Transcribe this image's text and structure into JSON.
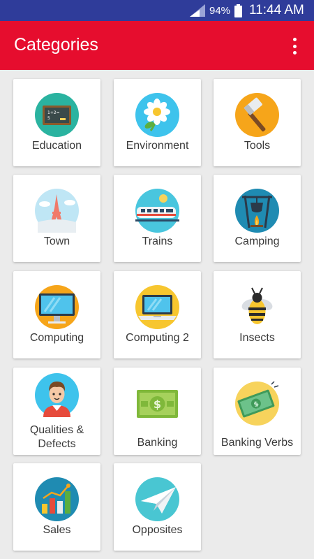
{
  "status_bar": {
    "battery": "94%",
    "time": "11:44 AM"
  },
  "app_bar": {
    "title": "Categories",
    "menu_icon": "more-vert-icon"
  },
  "colors": {
    "status": "#2f3c9a",
    "app_bar": "#e60d2e",
    "background": "#ebebeb"
  },
  "categories": [
    {
      "label": "Education",
      "icon": "chalkboard-icon"
    },
    {
      "label": "Environment",
      "icon": "flower-icon"
    },
    {
      "label": "Tools",
      "icon": "hammer-icon"
    },
    {
      "label": "Town",
      "icon": "eiffel-tower-icon"
    },
    {
      "label": "Trains",
      "icon": "train-icon"
    },
    {
      "label": "Camping",
      "icon": "campfire-icon"
    },
    {
      "label": "Computing",
      "icon": "monitor-icon"
    },
    {
      "label": "Computing 2",
      "icon": "laptop-icon"
    },
    {
      "label": "Insects",
      "icon": "bee-icon"
    },
    {
      "label": "Qualities & Defects",
      "icon": "person-icon"
    },
    {
      "label": "Banking",
      "icon": "banknote-icon"
    },
    {
      "label": "Banking Verbs",
      "icon": "cash-icon"
    },
    {
      "label": "Sales",
      "icon": "bar-chart-icon"
    },
    {
      "label": "Opposites",
      "icon": "paper-plane-icon"
    }
  ]
}
